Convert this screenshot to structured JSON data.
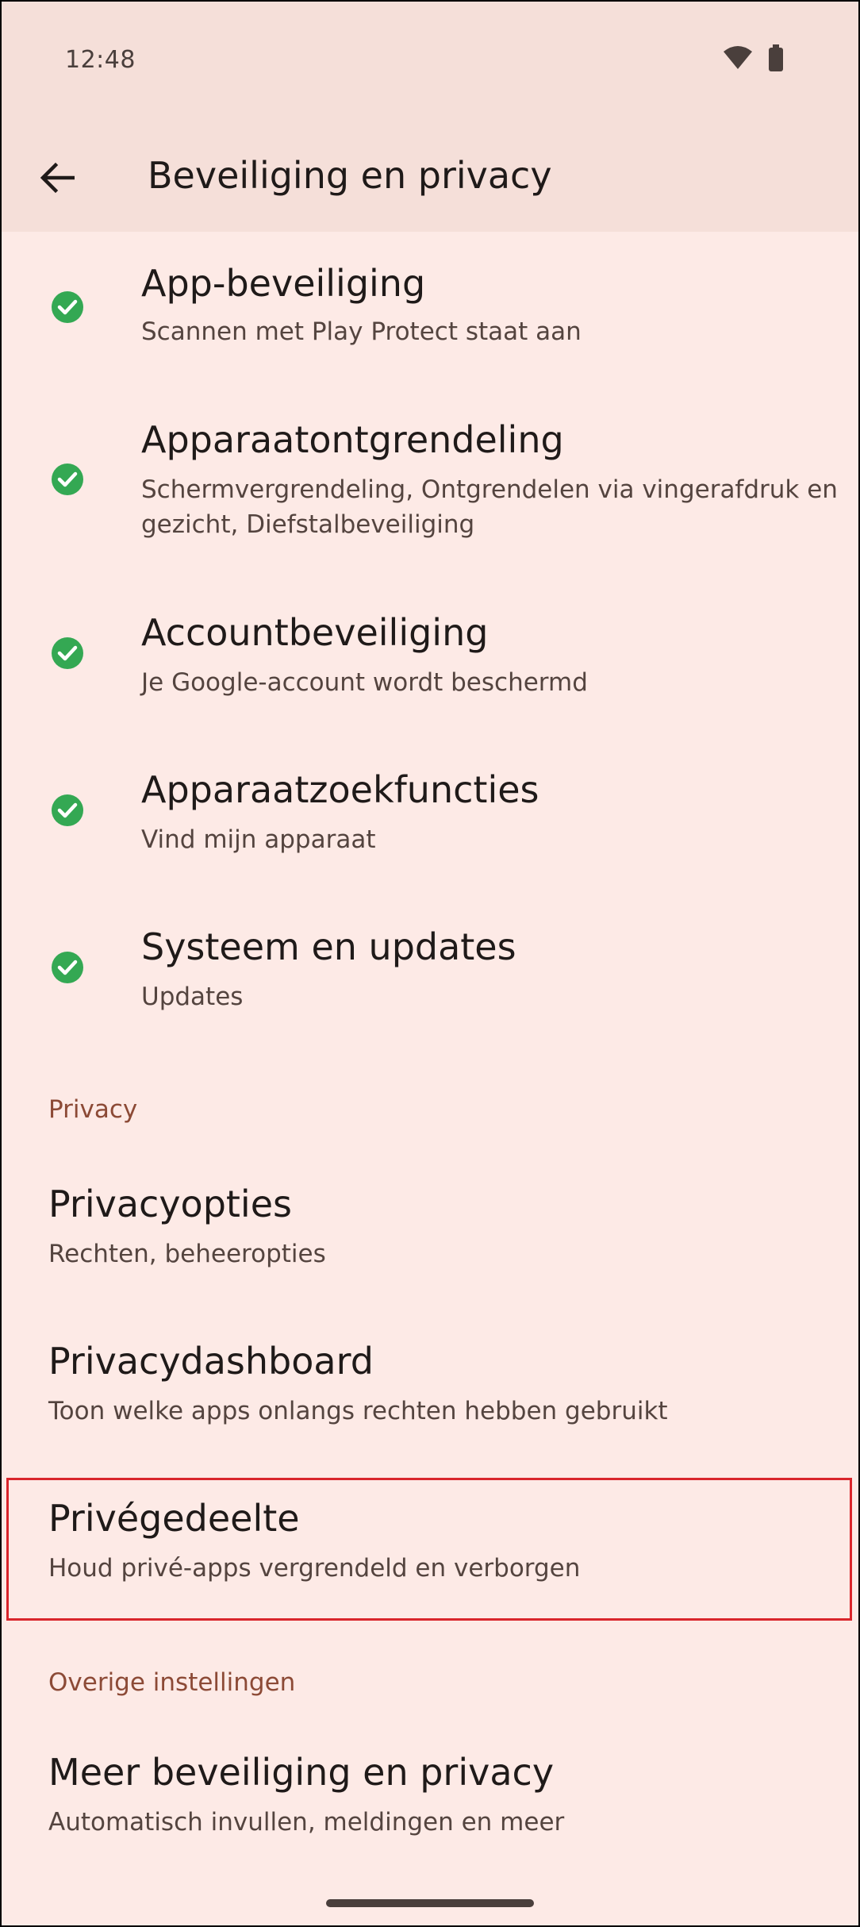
{
  "status_bar": {
    "time": "12:48",
    "icons": [
      "wifi-icon",
      "battery-icon"
    ]
  },
  "app_bar": {
    "back_icon": "arrow-left-icon",
    "title": "Beveiliging en privacy"
  },
  "security_items": [
    {
      "title": "App-beveiliging",
      "summary": "Scannen met Play Protect staat aan",
      "icon": "check-circle-icon"
    },
    {
      "title": "Apparaatontgrendeling",
      "summary": "Schermvergrendeling, Ontgrendelen via vingerafdruk en gezicht, Diefstalbeveiliging",
      "icon": "check-circle-icon"
    },
    {
      "title": "Accountbeveiliging",
      "summary": "Je Google-account wordt beschermd",
      "icon": "check-circle-icon"
    },
    {
      "title": "Apparaatzoekfuncties",
      "summary": "Vind mijn apparaat",
      "icon": "check-circle-icon"
    },
    {
      "title": "Systeem en updates",
      "summary": "Updates",
      "icon": "check-circle-icon"
    }
  ],
  "privacy_section": {
    "header": "Privacy",
    "items": [
      {
        "title": "Privacyopties",
        "summary": "Rechten, beheeropties"
      },
      {
        "title": "Privacydashboard",
        "summary": "Toon welke apps onlangs rechten hebben gebruikt"
      },
      {
        "title": "Privégedeelte",
        "summary": "Houd privé-apps vergrendeld en verborgen"
      }
    ]
  },
  "other_section": {
    "header": "Overige instellingen",
    "items": [
      {
        "title": "Meer beveiliging en privacy",
        "summary": "Automatisch invullen, meldingen en meer"
      }
    ]
  },
  "colors": {
    "background": "#FDEAE6",
    "app_bar": "#F5DFD9",
    "check_green": "#34A853",
    "section_header": "#8C4A36",
    "highlight_border": "#D9252B"
  }
}
